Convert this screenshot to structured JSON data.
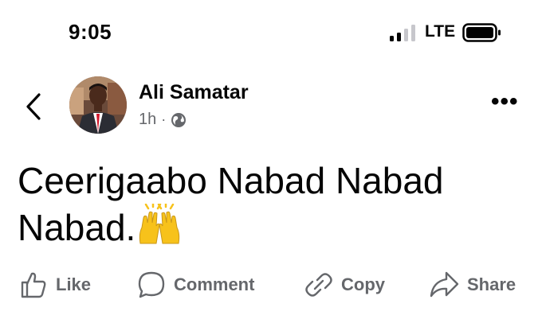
{
  "status_bar": {
    "time": "9:05",
    "network": "LTE"
  },
  "post": {
    "author": "Ali Samatar",
    "time_ago": "1h",
    "separator": "·",
    "audience_icon": "globe-icon",
    "text": "Ceerigaabo Nabad Nabad Nabad.",
    "emoji": "raising-hands-emoji"
  },
  "actions": {
    "like": "Like",
    "comment": "Comment",
    "copy": "Copy",
    "share": "Share"
  },
  "colors": {
    "text": "#050505",
    "secondary": "#65676b",
    "emoji": "#f7c21b"
  }
}
